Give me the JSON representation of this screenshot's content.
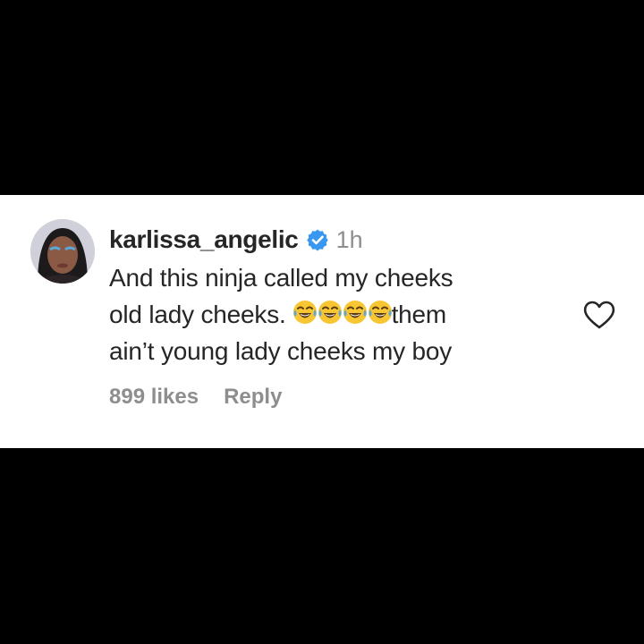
{
  "comment": {
    "username": "karlissa_angelic",
    "timestamp": "1h",
    "lines": [
      "And this ninja called my cheeks",
      "old lady cheeks.",
      "them",
      "ain’t young lady cheeks my boy"
    ],
    "emoji_icon": "face-with-tears-of-joy-icon",
    "emoji_count": 4,
    "likes_label": "899 likes",
    "reply_label": "Reply"
  },
  "icons": {
    "verified": "verified-badge-icon",
    "like": "heart-outline-icon"
  },
  "colors": {
    "background_bars": "#000000",
    "card": "#ffffff",
    "text_primary": "#262626",
    "text_secondary": "#8e8e8e",
    "verified_blue": "#3897f0"
  }
}
